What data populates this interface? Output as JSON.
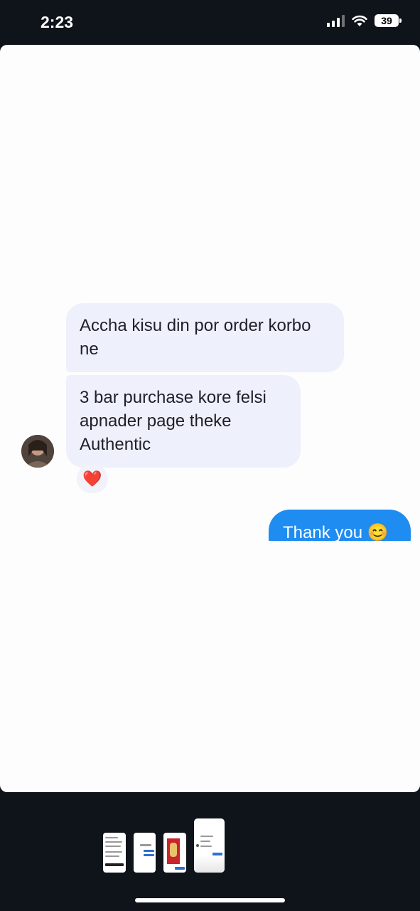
{
  "status_bar": {
    "time": "2:23",
    "battery": "39"
  },
  "messages": {
    "incoming": [
      {
        "text": "Accha kisu din por order korbo ne"
      },
      {
        "text": "3 bar purchase kore felsi apnader page theke Authentic"
      }
    ],
    "reaction": "❤️",
    "outgoing": {
      "text": "Thank you 😊"
    }
  },
  "thumbnails": {
    "count": 4,
    "selected_index": 3
  },
  "colors": {
    "incoming_bubble": "#eef0fb",
    "outgoing_bubble": "#1e8cf0",
    "background": "#0f141a"
  }
}
